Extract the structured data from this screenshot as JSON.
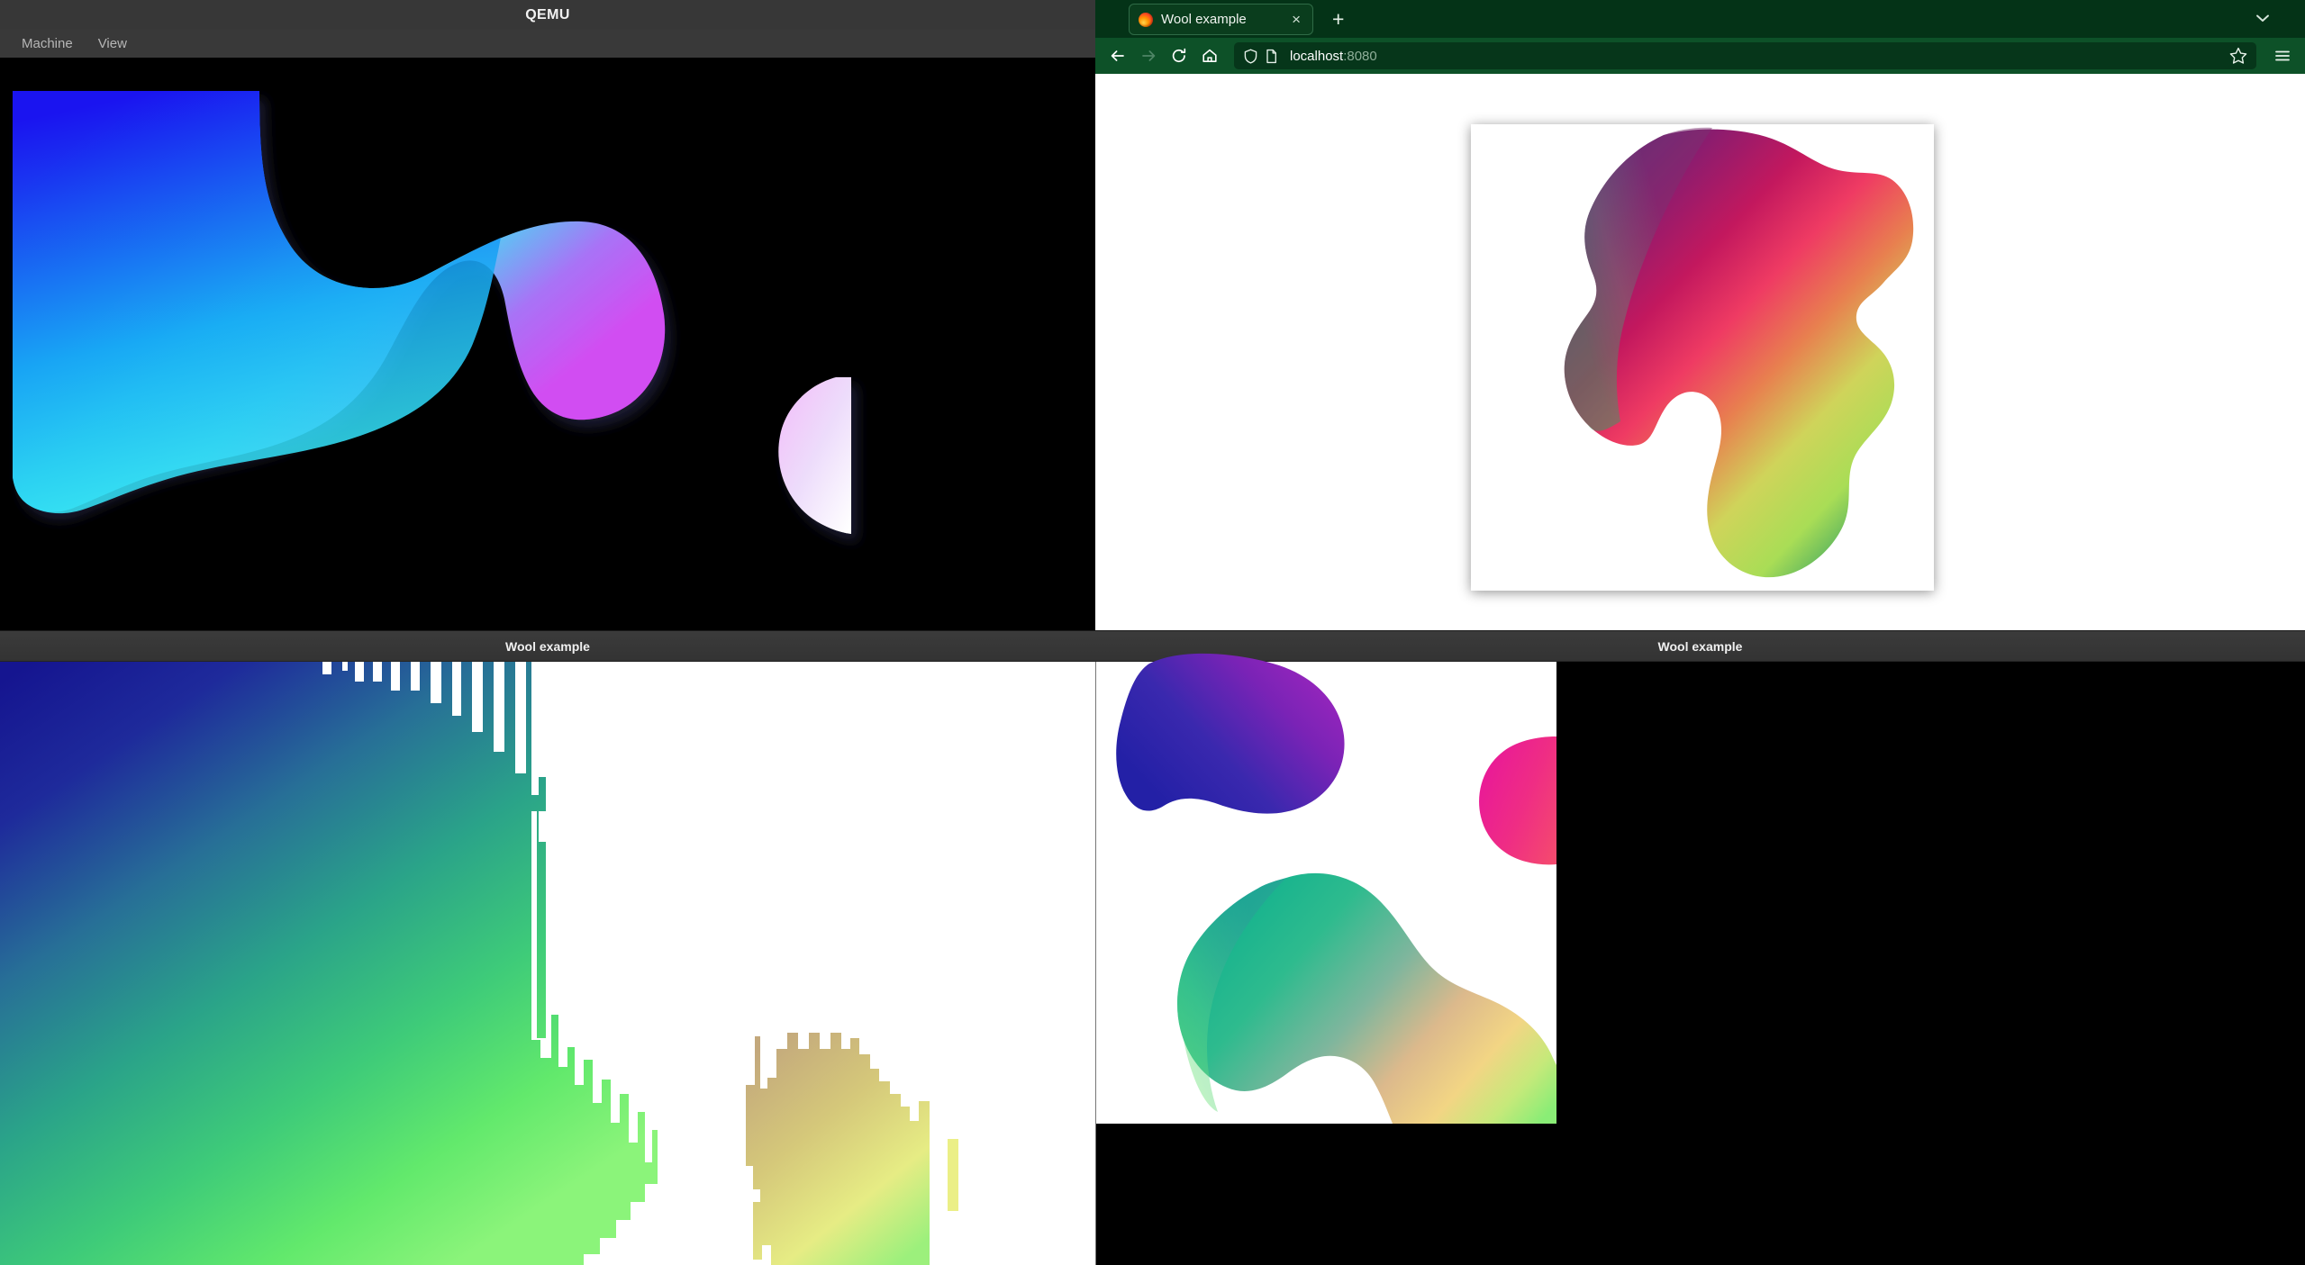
{
  "qemu": {
    "window_title": "QEMU",
    "menu": [
      {
        "label": "Machine",
        "name": "machine"
      },
      {
        "label": "View",
        "name": "view"
      }
    ],
    "screen_background": "#000000"
  },
  "firefox": {
    "theme_color": "#043317",
    "navbar_color": "#0d5128",
    "urlbar_color": "#06361a",
    "tab": {
      "title": "Wool example",
      "favicon": "firefox-icon",
      "close_label": "×"
    },
    "new_tab_label": "+",
    "tab_list_icon": "chevron-down-icon",
    "nav": {
      "back_icon": "back-arrow-icon",
      "forward_icon": "forward-arrow-icon",
      "reload_icon": "reload-icon",
      "home_icon": "home-icon"
    },
    "urlbar": {
      "shield_icon": "shield-icon",
      "page_icon": "page-icon",
      "host": "localhost",
      "port": ":8080",
      "bookmark_icon": "star-icon"
    },
    "menu_icon": "hamburger-menu-icon",
    "page_background": "#ffffff"
  },
  "panels": {
    "bottom_left_title": "Wool example",
    "bottom_right_title": "Wool example"
  },
  "shapes": {
    "qemu_main_blob": {
      "name": "gradient-blob-blue-cyan-magenta",
      "stops": [
        "#1a14f0",
        "#1566f5",
        "#22d3f0",
        "#3df1f1",
        "#b664f5",
        "#d14ef2"
      ]
    },
    "qemu_small_blob": {
      "name": "pale-pink-circle-blob",
      "stops": [
        "#f6c8f8",
        "#f1e2fb",
        "#ffffff"
      ]
    },
    "browser_blob": {
      "name": "gradient-blob-multicolor",
      "stops": [
        "#6d2a74",
        "#c3185e",
        "#ef3b63",
        "#e8804f",
        "#cfd45a",
        "#a9dd56",
        "#2f9e63"
      ]
    },
    "wool_left_blob": {
      "name": "aliased-blob-navy-teal-green",
      "stops": [
        "#1a1a8c",
        "#27309a",
        "#2a7f95",
        "#2fb083",
        "#56e36a",
        "#8ef07a"
      ]
    },
    "wool_left_small_blob": {
      "name": "aliased-blob-tan-yellowgreen",
      "stops": [
        "#c8aa7d",
        "#d9cf7a",
        "#e9ee85",
        "#a6ef7e"
      ]
    },
    "wool_right_blob_top": {
      "name": "blob-blue-purple",
      "stops": [
        "#2a23a8",
        "#3a2bb0",
        "#7a25b5",
        "#9b27bd"
      ]
    },
    "wool_right_circle": {
      "name": "circle-magenta-pink",
      "stops": [
        "#e8179a",
        "#f0337f",
        "#f4496f"
      ]
    },
    "wool_right_blob_bottom": {
      "name": "blob-teal-green-orange",
      "stops": [
        "#19b48f",
        "#3bbf8f",
        "#8fb79a",
        "#e0b98a",
        "#f2d584",
        "#c8ea7a",
        "#8ced76"
      ]
    }
  }
}
